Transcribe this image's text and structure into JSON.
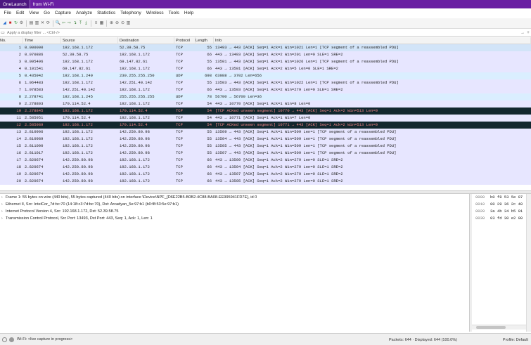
{
  "window": {
    "tabs": [
      "OneLaunch",
      "from Wi-Fi"
    ]
  },
  "menu": [
    "File",
    "Edit",
    "View",
    "Go",
    "Capture",
    "Analyze",
    "Statistics",
    "Telephony",
    "Wireless",
    "Tools",
    "Help"
  ],
  "toolbar": {
    "icons": [
      "shark-fin-icon",
      "stop-icon",
      "restart-icon",
      "options-icon",
      "open-file-icon",
      "save-icon",
      "close-file-icon",
      "reload-icon",
      "find-icon",
      "go-back-icon",
      "go-forward-icon",
      "go-to-packet-icon",
      "first-packet-icon",
      "last-packet-icon",
      "autoscroll-icon",
      "colorize-icon",
      "zoom-in-icon",
      "zoom-out-icon",
      "normal-size-icon",
      "resize-columns-icon"
    ],
    "glyphs": [
      "◢",
      "■",
      "↻",
      "⚙",
      "▤",
      "▥",
      "✕",
      "⟳",
      "🔍",
      "⇦",
      "⇨",
      "↴",
      "⤒",
      "⤓",
      "≡",
      "▦",
      "⊕",
      "⊖",
      "⊙",
      "▥"
    ]
  },
  "filter": {
    "placeholder": "Apply a display filter ... <Ctrl-/>"
  },
  "columns": {
    "no": "No.",
    "time": "Time",
    "source": "Source",
    "destination": "Destination",
    "protocol": "Protocol",
    "length": "Length",
    "info": "Info"
  },
  "colors": {
    "tcp": "#e7e6ff",
    "udp": "#daeeff",
    "bad_tcp_bg": "#12272e",
    "bad_tcp_fg": "#f78787",
    "selected_bg": "#d2e4f8"
  },
  "packets": [
    {
      "no": "1",
      "time": "0.000000",
      "src": "192.168.1.172",
      "dst": "52.39.58.75",
      "proto": "TCP",
      "len": "55",
      "info": "13493 → 443 [ACK] Seq=1 Ack=1 Win=1021 Len=1 [TCP segment of a reassembled PDU]",
      "style": "sel"
    },
    {
      "no": "2",
      "time": "0.070886",
      "src": "52.39.58.75",
      "dst": "192.168.1.172",
      "proto": "TCP",
      "len": "66",
      "info": "443 → 13493 [ACK] Seq=1 Ack=2 Win=201 Len=0 SLE=1 SRE=2",
      "style": "tcp"
    },
    {
      "no": "3",
      "time": "0.095496",
      "src": "192.168.1.172",
      "dst": "69.147.82.61",
      "proto": "TCP",
      "len": "55",
      "info": "13501 → 443 [ACK] Seq=1 Ack=1 Win=1026 Len=1 [TCP segment of a reassembled PDU]",
      "style": "tcp"
    },
    {
      "no": "4",
      "time": "0.101541",
      "src": "69.147.82.61",
      "dst": "192.168.1.172",
      "proto": "TCP",
      "len": "66",
      "info": "443 → 13501 [ACK] Seq=1 Ack=2 Win=5 Len=0 SLE=1 SRE=2",
      "style": "tcp"
    },
    {
      "no": "5",
      "time": "0.435942",
      "src": "192.168.1.240",
      "dst": "239.255.255.250",
      "proto": "UDP",
      "len": "698",
      "info": "63088 → 3702 Len=656",
      "style": "udp"
    },
    {
      "no": "6",
      "time": "1.064483",
      "src": "192.168.1.172",
      "dst": "142.251.40.142",
      "proto": "TCP",
      "len": "55",
      "info": "13503 → 443 [ACK] Seq=1 Ack=1 Win=1022 Len=1 [TCP segment of a reassembled PDU]",
      "style": "tcp"
    },
    {
      "no": "7",
      "time": "1.078583",
      "src": "142.251.40.142",
      "dst": "192.168.1.172",
      "proto": "TCP",
      "len": "66",
      "info": "443 → 13503 [ACK] Seq=1 Ack=2 Win=279 Len=0 SLE=1 SRE=2",
      "style": "tcp"
    },
    {
      "no": "8",
      "time": "2.278741",
      "src": "192.168.1.245",
      "dst": "255.255.255.255",
      "proto": "UDP",
      "len": "78",
      "info": "56700 → 56700 Len=36",
      "style": "udp"
    },
    {
      "no": "9",
      "time": "2.278803",
      "src": "170.114.52.4",
      "dst": "192.168.1.172",
      "proto": "TCP",
      "len": "54",
      "info": "443 → 10770 [ACK] Seq=1 Ack=1 Win=8 Len=0",
      "style": "tcp"
    },
    {
      "no": "10",
      "time": "2.278845",
      "src": "192.168.1.172",
      "dst": "170.114.52.4",
      "proto": "TCP",
      "len": "54",
      "info": "[TCP ACKed unseen segment] 10770 → 443 [ACK] Seq=1 Ack=2 Win=513 Len=0",
      "style": "bad"
    },
    {
      "no": "11",
      "time": "2.585951",
      "src": "170.114.52.4",
      "dst": "192.168.1.172",
      "proto": "TCP",
      "len": "54",
      "info": "443 → 10771 [ACK] Seq=1 Ack=1 Win=7 Len=0",
      "style": "tcp"
    },
    {
      "no": "12",
      "time": "2.585989",
      "src": "192.168.1.172",
      "dst": "170.114.52.4",
      "proto": "TCP",
      "len": "54",
      "info": "[TCP ACKed unseen segment] 10771 → 443 [ACK] Seq=1 Ack=2 Win=513 Len=0",
      "style": "bad"
    },
    {
      "no": "13",
      "time": "2.810906",
      "src": "192.168.1.172",
      "dst": "142.250.80.98",
      "proto": "TCP",
      "len": "55",
      "info": "13509 → 443 [ACK] Seq=1 Ack=1 Win=509 Len=1 [TCP segment of a reassembled PDU]",
      "style": "tcp"
    },
    {
      "no": "14",
      "time": "2.810989",
      "src": "192.168.1.172",
      "dst": "142.250.80.98",
      "proto": "TCP",
      "len": "55",
      "info": "13504 → 443 [ACK] Seq=1 Ack=1 Win=509 Len=1 [TCP segment of a reassembled PDU]",
      "style": "tcp"
    },
    {
      "no": "15",
      "time": "2.811000",
      "src": "192.168.1.172",
      "dst": "142.250.80.98",
      "proto": "TCP",
      "len": "55",
      "info": "13505 → 443 [ACK] Seq=1 Ack=1 Win=509 Len=1 [TCP segment of a reassembled PDU]",
      "style": "tcp"
    },
    {
      "no": "16",
      "time": "2.811017",
      "src": "192.168.1.172",
      "dst": "142.250.80.98",
      "proto": "TCP",
      "len": "55",
      "info": "13507 → 443 [ACK] Seq=1 Ack=1 Win=509 Len=1 [TCP segment of a reassembled PDU]",
      "style": "tcp"
    },
    {
      "no": "17",
      "time": "2.820674",
      "src": "142.250.80.98",
      "dst": "192.168.1.172",
      "proto": "TCP",
      "len": "66",
      "info": "443 → 13509 [ACK] Seq=1 Ack=2 Win=279 Len=0 SLE=1 SRE=2",
      "style": "tcp"
    },
    {
      "no": "18",
      "time": "2.820674",
      "src": "142.250.80.98",
      "dst": "192.168.1.172",
      "proto": "TCP",
      "len": "66",
      "info": "443 → 13504 [ACK] Seq=1 Ack=2 Win=279 Len=0 SLE=1 SRE=2",
      "style": "tcp"
    },
    {
      "no": "19",
      "time": "2.820674",
      "src": "142.250.80.98",
      "dst": "192.168.1.172",
      "proto": "TCP",
      "len": "66",
      "info": "443 → 13507 [ACK] Seq=1 Ack=2 Win=279 Len=0 SLE=1 SRE=2",
      "style": "tcp"
    },
    {
      "no": "20",
      "time": "2.820674",
      "src": "142.250.80.98",
      "dst": "192.168.1.172",
      "proto": "TCP",
      "len": "66",
      "info": "443 → 13505 [ACK] Seq=1 Ack=2 Win=279 Len=0 SLE=1 SRE=2",
      "style": "tcp"
    }
  ],
  "details": [
    "Frame 1: 55 bytes on wire (440 bits), 55 bytes captured (440 bits) on interface \\Device\\NPF_{D6E22B5-B0B2-4C88-BA08-EE995941FD7E}, id 0",
    "Ethernet II, Src: IntelCor_7d:bc:70 (14:18:c3:7d:bc:70), Dst: Arcadyan_5e:97:b1 (b0:f8:53:5e:97:b1)",
    "Internet Protocol Version 4, Src: 192.168.1.172, Dst: 52.39.58.75",
    "Transmission Control Protocol, Src Port: 13493, Dst Port: 443, Seq: 1, Ack: 1, Len: 1"
  ],
  "bytes": [
    {
      "offset": "0000",
      "hex": "b0 f8 53 5e 97"
    },
    {
      "offset": "0010",
      "hex": "00 29 36 2c 40"
    },
    {
      "offset": "0020",
      "hex": "3a 4b 34 b5 01"
    },
    {
      "offset": "0030",
      "hex": "03 fd 30 e2 00"
    }
  ],
  "status": {
    "capture": "Wi-Fi: <live capture in progress>",
    "packets": "Packets: 644 · Displayed: 644 (100.0%)",
    "profile": "Profile: Default"
  }
}
